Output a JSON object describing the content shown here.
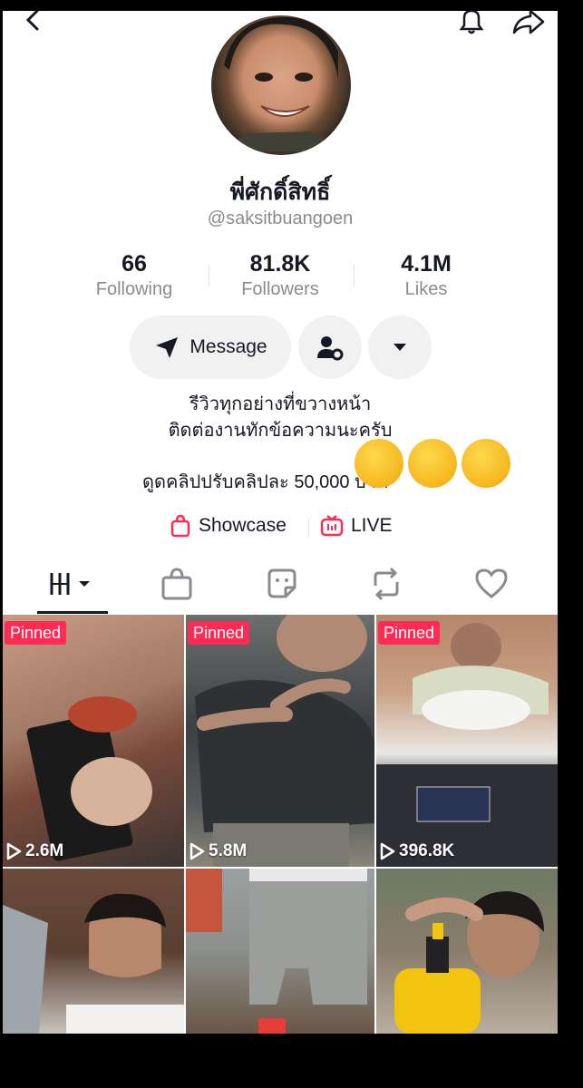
{
  "profile": {
    "display_name": "พี่ศักดิ์สิทธิ์",
    "username": "@saksitbuangoen"
  },
  "stats": [
    {
      "value": "66",
      "label": "Following"
    },
    {
      "value": "81.8K",
      "label": "Followers"
    },
    {
      "value": "4.1M",
      "label": "Likes"
    }
  ],
  "actions": {
    "message_label": "Message"
  },
  "bio": {
    "line1": "รีวิวทุกอย่างที่ขวางหน้า",
    "line2": "ติดต่องานทักข้อความนะครับ",
    "line3": "ดูดคลิปปรับคลิปละ 50,000 บาท"
  },
  "links": {
    "showcase_label": "Showcase",
    "live_label": "LIVE"
  },
  "videos": [
    {
      "badge": "Pinned",
      "views": "2.6M"
    },
    {
      "badge": "Pinned",
      "views": "5.8M"
    },
    {
      "badge": "Pinned",
      "views": "396.8K"
    }
  ],
  "colors": {
    "accent": "#fe2c55",
    "text_primary": "#161823",
    "text_secondary": "#8a8b91"
  }
}
